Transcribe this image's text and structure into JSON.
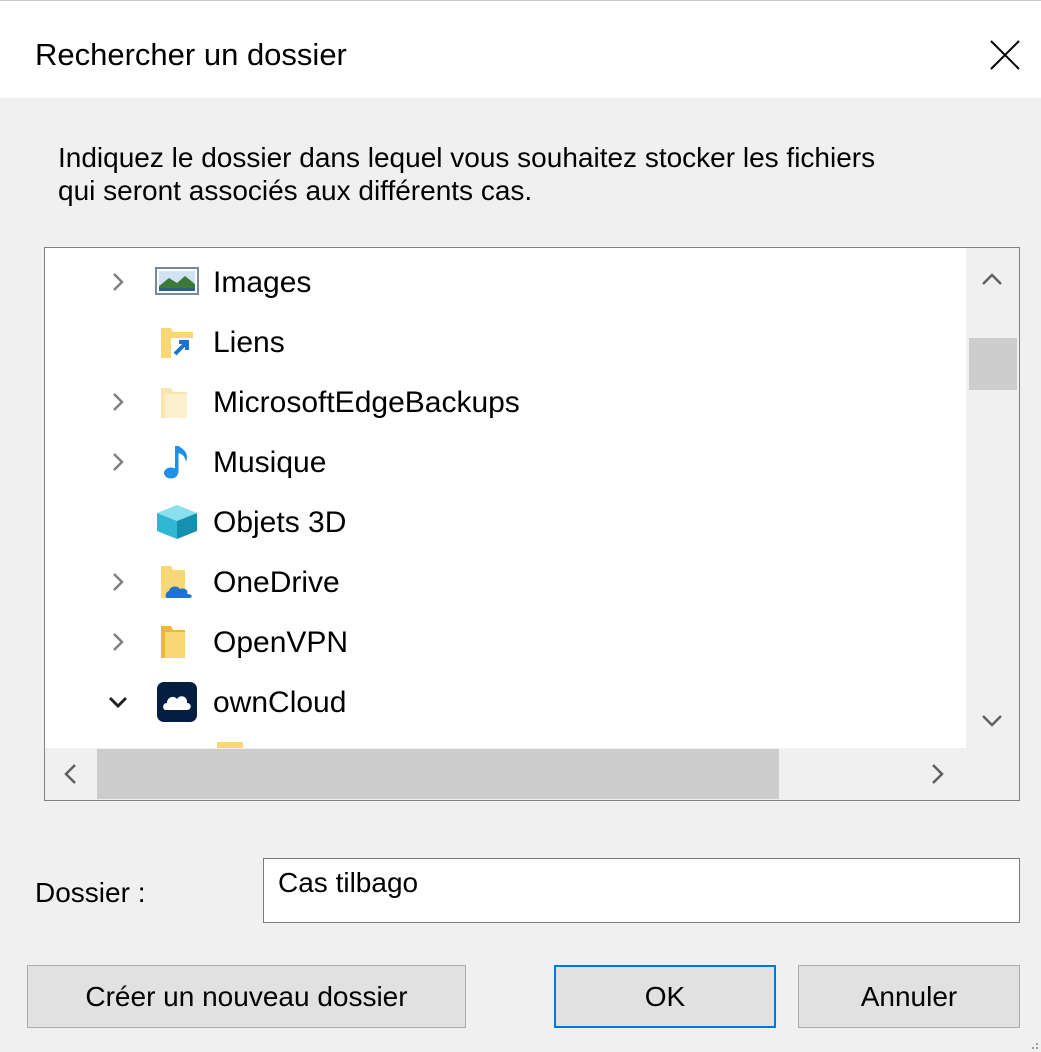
{
  "window": {
    "title": "Rechercher un dossier"
  },
  "prompt": {
    "line1": "Indiquez le dossier dans lequel vous souhaitez stocker les fichiers",
    "line2": "qui seront associés aux différents cas."
  },
  "tree": {
    "items": [
      {
        "label": "Images",
        "icon": "pictures-icon",
        "expandable": true,
        "expanded": false
      },
      {
        "label": "Liens",
        "icon": "links-folder-icon",
        "expandable": false,
        "expanded": false
      },
      {
        "label": "MicrosoftEdgeBackups",
        "icon": "folder-icon",
        "expandable": true,
        "expanded": false
      },
      {
        "label": "Musique",
        "icon": "music-icon",
        "expandable": true,
        "expanded": false
      },
      {
        "label": "Objets 3D",
        "icon": "3d-objects-icon",
        "expandable": false,
        "expanded": false
      },
      {
        "label": "OneDrive",
        "icon": "onedrive-icon",
        "expandable": true,
        "expanded": false
      },
      {
        "label": "OpenVPN",
        "icon": "folder-icon",
        "expandable": true,
        "expanded": false
      },
      {
        "label": "ownCloud",
        "icon": "owncloud-icon",
        "expandable": true,
        "expanded": true
      }
    ]
  },
  "folder": {
    "label": "Dossier :",
    "value": "Cas tilbago"
  },
  "buttons": {
    "new_folder": "Créer un nouveau dossier",
    "ok": "OK",
    "cancel": "Annuler"
  },
  "colors": {
    "dialog_bg": "#f0f0f0",
    "accent": "#0078d7",
    "folder_yellow": "#f8d775",
    "owncloud_navy": "#041e42",
    "music_blue": "#1e90e6"
  }
}
